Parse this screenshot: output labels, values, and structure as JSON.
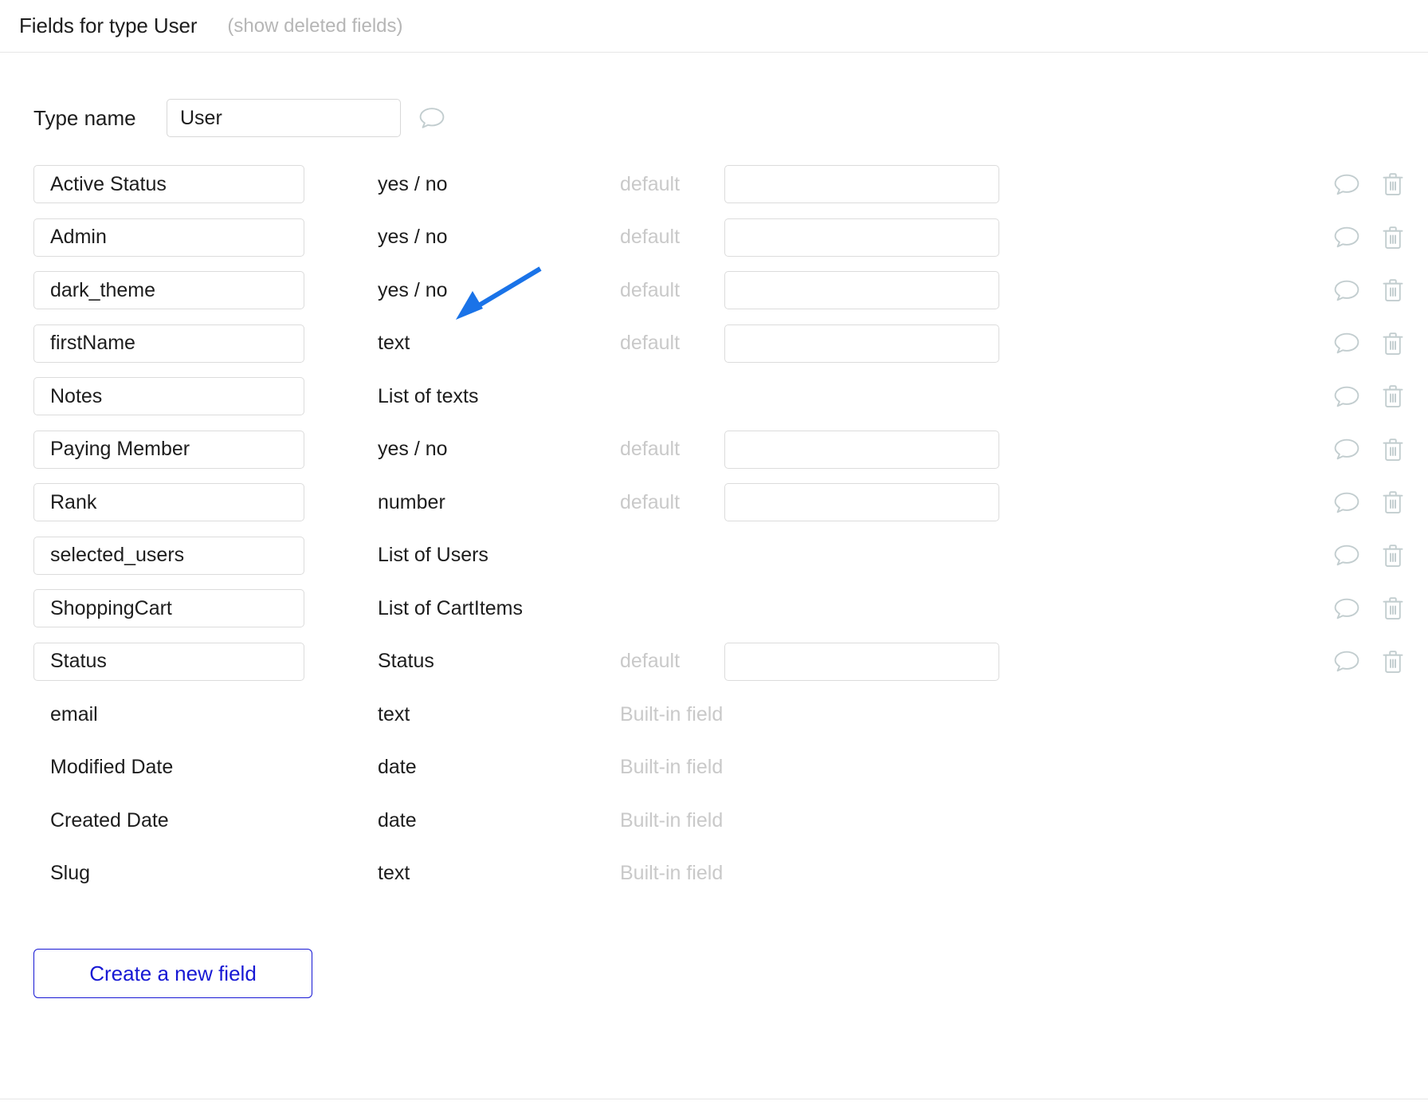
{
  "header": {
    "title": "Fields for type User",
    "show_deleted_link": "(show deleted fields)"
  },
  "type_name": {
    "label": "Type name",
    "value": "User",
    "comment_icon": "comment-bubble-icon"
  },
  "table": {
    "default_label": "default",
    "builtin_label": "Built-in field",
    "comment_icon": "comment-bubble-icon",
    "delete_icon": "trash-icon",
    "dropdown_icon": "caret-down-icon"
  },
  "fields": [
    {
      "name": "Active Status",
      "type": "yes / no",
      "editable": true,
      "default_control": "select",
      "default_value": ""
    },
    {
      "name": "Admin",
      "type": "yes / no",
      "editable": true,
      "default_control": "select",
      "default_value": ""
    },
    {
      "name": "dark_theme",
      "type": "yes / no",
      "editable": true,
      "default_control": "select",
      "default_value": ""
    },
    {
      "name": "firstName",
      "type": "text",
      "editable": true,
      "default_control": "text",
      "default_value": ""
    },
    {
      "name": "Notes",
      "type": "List of texts",
      "editable": true,
      "default_control": "none",
      "default_value": ""
    },
    {
      "name": "Paying Member",
      "type": "yes / no",
      "editable": true,
      "default_control": "select",
      "default_value": ""
    },
    {
      "name": "Rank",
      "type": "number",
      "editable": true,
      "default_control": "text",
      "default_value": ""
    },
    {
      "name": "selected_users",
      "type": "List of Users",
      "editable": true,
      "default_control": "none",
      "default_value": ""
    },
    {
      "name": "ShoppingCart",
      "type": "List of CartItems",
      "editable": true,
      "default_control": "none",
      "default_value": ""
    },
    {
      "name": "Status",
      "type": "Status",
      "editable": true,
      "default_control": "select",
      "default_value": ""
    },
    {
      "name": "email",
      "type": "text",
      "editable": false,
      "default_control": "builtin",
      "default_value": ""
    },
    {
      "name": "Modified Date",
      "type": "date",
      "editable": false,
      "default_control": "builtin",
      "default_value": ""
    },
    {
      "name": "Created Date",
      "type": "date",
      "editable": false,
      "default_control": "builtin",
      "default_value": ""
    },
    {
      "name": "Slug",
      "type": "text",
      "editable": false,
      "default_control": "builtin",
      "default_value": ""
    }
  ],
  "create_button": {
    "label": "Create a new field"
  },
  "annotation": {
    "type": "arrow",
    "color": "#1a73e8",
    "points_at": "dark_theme row type column"
  },
  "colors": {
    "accent_blue": "#1718d4",
    "annotation_blue": "#1a73e8",
    "muted_text": "#c9c9c9",
    "icon_gray": "#c2cdcf",
    "border": "#dcdcdc"
  }
}
